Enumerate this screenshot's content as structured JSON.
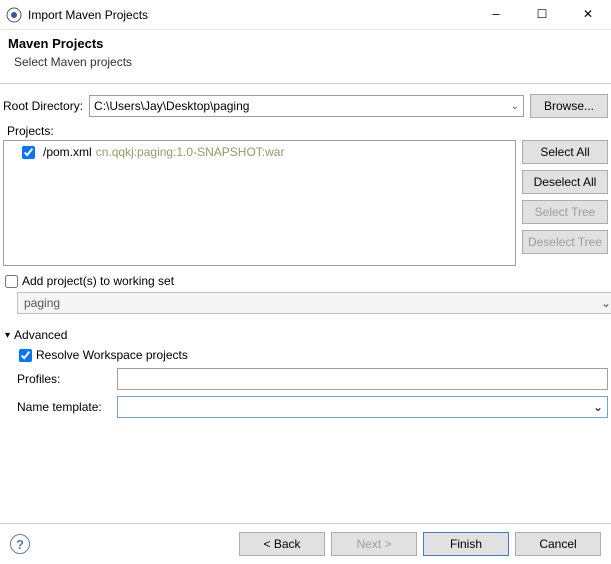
{
  "window": {
    "title": "Import Maven Projects"
  },
  "header": {
    "title": "Maven Projects",
    "subtitle": "Select Maven projects"
  },
  "rootDir": {
    "label": "Root Directory:",
    "value": "C:\\Users\\Jay\\Desktop\\paging",
    "browse": "Browse..."
  },
  "projects": {
    "label": "Projects:",
    "items": [
      {
        "checked": true,
        "path": "/pom.xml",
        "coord": "cn.qqkj:paging:1.0-SNAPSHOT:war"
      }
    ],
    "buttons": {
      "selectAll": "Select All",
      "deselectAll": "Deselect All",
      "selectTree": "Select Tree",
      "deselectTree": "Deselect Tree"
    }
  },
  "workingSet": {
    "label": "Add project(s) to working set",
    "checked": false,
    "value": "paging"
  },
  "advanced": {
    "label": "Advanced",
    "expanded": true,
    "resolveWorkspace": {
      "label": "Resolve Workspace projects",
      "checked": true
    },
    "profiles": {
      "label": "Profiles:",
      "value": ""
    },
    "nameTemplate": {
      "label": "Name template:",
      "value": ""
    }
  },
  "wizard": {
    "help": "?",
    "back": "< Back",
    "next": "Next >",
    "finish": "Finish",
    "cancel": "Cancel"
  }
}
